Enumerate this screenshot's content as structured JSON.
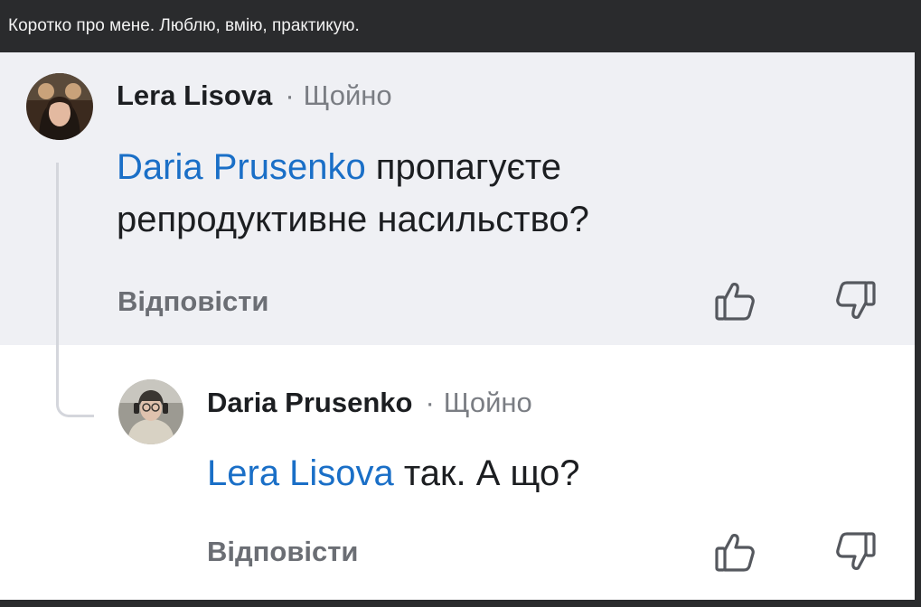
{
  "window": {
    "title": "Коротко про мене. Люблю, вмію, практикую."
  },
  "comments": [
    {
      "author": "Lera Lisova",
      "separator": "·",
      "time": "Щойно",
      "mention": "Daria Prusenko",
      "text": " пропагуєте репродуктивне насильство?",
      "reply_label": "Відповісти",
      "highlighted": true,
      "like_icon": "thumbs-up-icon",
      "dislike_icon": "thumbs-down-icon"
    },
    {
      "author": "Daria Prusenko",
      "separator": "·",
      "time": "Щойно",
      "mention": "Lera Lisova",
      "text": " так. А що?",
      "reply_label": "Відповісти",
      "highlighted": false,
      "like_icon": "thumbs-up-icon",
      "dislike_icon": "thumbs-down-icon"
    }
  ],
  "colors": {
    "mention": "#1a6fc7",
    "highlight_bg": "#eff0f4",
    "muted_text": "#6b6e74",
    "window_bar": "#2a2b2d"
  }
}
